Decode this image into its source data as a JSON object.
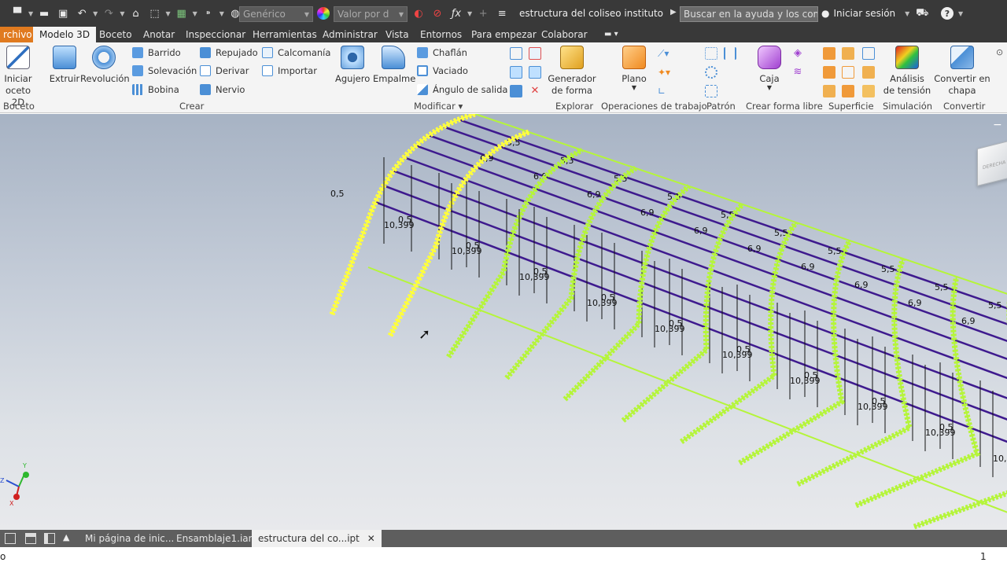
{
  "titlebar": {
    "material": "Genérico",
    "appearance": "Valor por d",
    "doc_title": "estructura del coliseo instituto",
    "search_placeholder": "Buscar en la ayuda y los comandos",
    "signin": "Iniciar sesión",
    "help": "?"
  },
  "tabs": [
    "rchivo",
    "Modelo 3D",
    "Boceto",
    "Anotar",
    "Inspeccionar",
    "Herramientas",
    "Administrar",
    "Vista",
    "Entornos",
    "Para empezar",
    "Colaborar"
  ],
  "ribbon": {
    "boceto": {
      "start_line1": "Iniciar",
      "start_line2": "oceto 2D",
      "group": "Boceto"
    },
    "crear": {
      "extruir": "Extruir",
      "revolucion": "Revolución",
      "barrido": "Barrido",
      "solevacion": "Solevación",
      "bobina": "Bobina",
      "repujado": "Repujado",
      "derivar": "Derivar",
      "nervio": "Nervio",
      "calcomania": "Calcomanía",
      "importar": "Importar",
      "group": "Crear"
    },
    "modificar": {
      "agujero": "Agujero",
      "empalme": "Empalme",
      "chaflan": "Chaflán",
      "vaciado": "Vaciado",
      "angulo": "Ángulo de salida",
      "group": "Modificar ▾"
    },
    "explorar": {
      "gen_line1": "Generador",
      "gen_line2": "de forma",
      "group": "Explorar"
    },
    "ops": {
      "plano": "Plano",
      "group": "Operaciones de trabajo"
    },
    "patron": {
      "group": "Patrón"
    },
    "freeform": {
      "caja": "Caja",
      "group": "Crear forma libre"
    },
    "superficie": {
      "group": "Superficie"
    },
    "simulacion": {
      "line1": "Análisis",
      "line2": "de tensión",
      "group": "Simulación"
    },
    "convertir": {
      "line1": "Convertir en",
      "line2": "chapa",
      "group": "Convertir"
    }
  },
  "viewport": {
    "labels_half": "0,5",
    "labels_length": "10,399",
    "labels_69": "6,9",
    "labels_55": "5,5",
    "viewcube_face": "DERECHA",
    "triad": {
      "x": "X",
      "y": "Y",
      "z": "Z"
    },
    "colors": {
      "frame": "#b5f53a",
      "frame_selected": "#ffff3c",
      "purlin": "#3e1a8e",
      "dim": "#111111"
    }
  },
  "doctabs": [
    "Mi página de inic...",
    "Ensamblaje1.iam",
    "estructura del co...ipt"
  ],
  "status": {
    "left": "o",
    "right": "1"
  }
}
